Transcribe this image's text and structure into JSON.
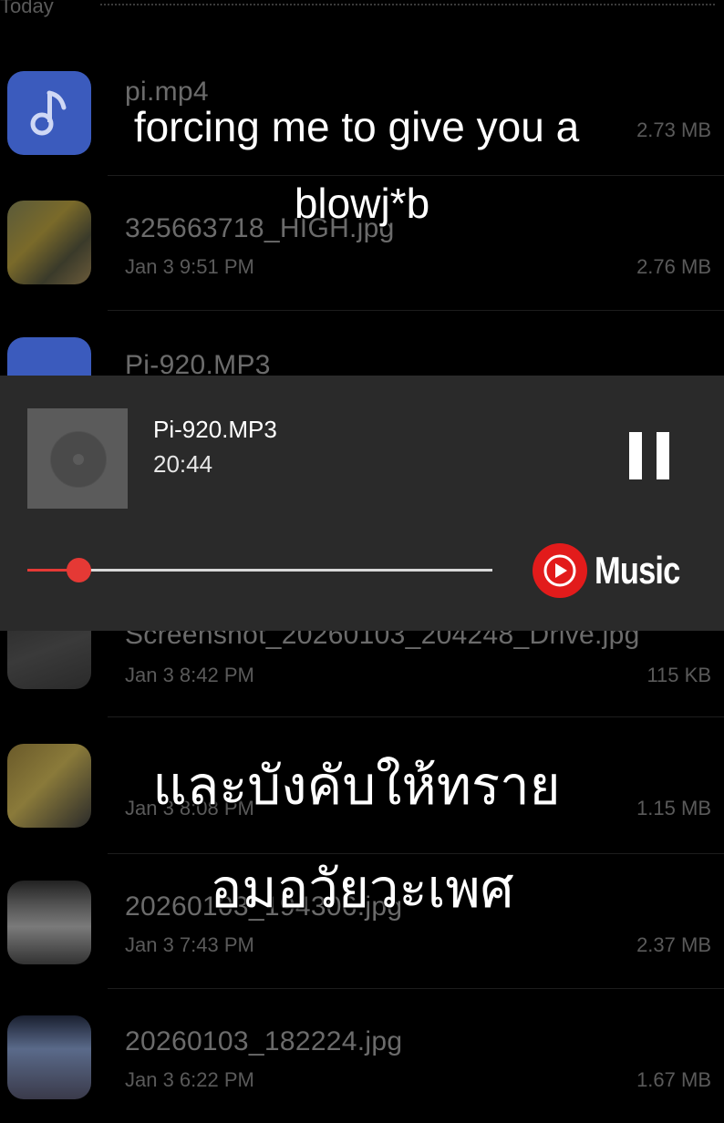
{
  "section": {
    "label": "Today"
  },
  "files": [
    {
      "name": "pi.mp4",
      "date": "",
      "size": "2.73 MB",
      "thumb_icon": "music-note-icon"
    },
    {
      "name": "325663718_HIGH.jpg",
      "date": "Jan 3 9:51 PM",
      "size": "2.76 MB",
      "thumb_icon": "photo-thumbnail"
    },
    {
      "name": "Pi-920.MP3",
      "date": "",
      "size": "",
      "thumb_icon": "music-note-icon"
    },
    {
      "name": "Screenshot_20260103_204248_Drive.jpg",
      "date": "Jan 3 8:42 PM",
      "size": "115 KB",
      "thumb_icon": "photo-thumbnail"
    },
    {
      "name": "",
      "date": "Jan 3 8:08 PM",
      "size": "1.15 MB",
      "thumb_icon": "photo-thumbnail"
    },
    {
      "name": "20260103_194306.jpg",
      "date": "Jan 3 7:43 PM",
      "size": "2.37 MB",
      "thumb_icon": "photo-thumbnail"
    },
    {
      "name": "20260103_182224.jpg",
      "date": "Jan 3 6:22 PM",
      "size": "1.67 MB",
      "thumb_icon": "photo-thumbnail"
    }
  ],
  "player": {
    "title": "Pi-920.MP3",
    "time": "20:44",
    "progress": 0.11,
    "brand": "Music",
    "accent": "#e53935",
    "pause_icon": "pause-icon"
  },
  "captions": {
    "line1": "forcing me to give you a",
    "line2": "blowj*b",
    "line3": "และบังคับให้ทราย",
    "line4": "อมอวัยวะเพศ"
  }
}
